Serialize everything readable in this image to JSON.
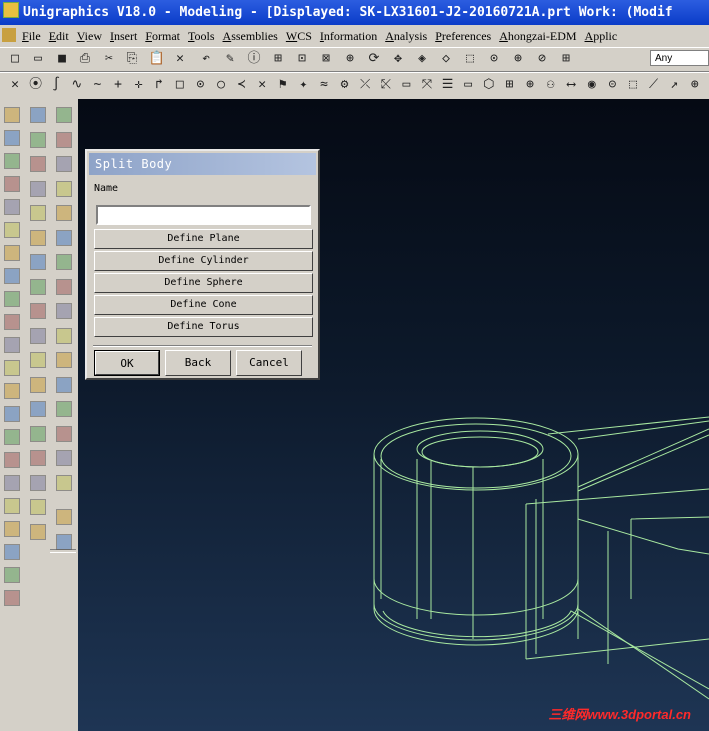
{
  "window": {
    "title": "Unigraphics V18.0 - Modeling - [Displayed: SK-LX31601-J2-20160721A.prt   Work:  (Modif"
  },
  "menu": [
    "File",
    "Edit",
    "View",
    "Insert",
    "Format",
    "Tools",
    "Assemblies",
    "WCS",
    "Information",
    "Analysis",
    "Preferences",
    "Ahongzai-EDM",
    "Applic"
  ],
  "toolbar": {
    "row1_icons": [
      "new-icon",
      "open-icon",
      "save-icon",
      "print-icon",
      "cut-icon",
      "copy-icon",
      "paste-icon",
      "delete-icon",
      "undo-icon",
      "edit-icon",
      "info-icon",
      "tree-icon",
      "measure-icon",
      "fit-icon",
      "zoom-region-icon",
      "zoom-icon",
      "rotate-icon",
      "pan-icon",
      "iso-view-icon",
      "shaded-view-icon",
      "snap-icon",
      "snap-end-icon",
      "snap-mid-icon",
      "layer-icon"
    ],
    "row1_glyphs": [
      "□",
      "▭",
      "■",
      "⎙",
      "✂",
      "⎘",
      "📋",
      "✕",
      "↶",
      "✎",
      "ⓘ",
      "⊞",
      "⊡",
      "⊠",
      "⊕",
      "⟳",
      "✥",
      "◈",
      "◇",
      "⬚",
      "⊙",
      "⊕",
      "⊘",
      "⊞"
    ],
    "filter_value": "Any",
    "row2_glyphs": [
      "✕",
      "⦿",
      "∫",
      "∿",
      "∼",
      "+",
      "✛",
      "↱",
      "□",
      "⊙",
      "○",
      "≺",
      "✕",
      "⚑",
      "✦",
      "≈",
      "⚙",
      "⤫",
      "⤪",
      "▭",
      "⤧",
      "☰",
      "▭",
      "⬡",
      "⊞",
      "⊕",
      "⚇",
      "⟷",
      "◉",
      "⊝",
      "⬚",
      "⟋",
      "↗",
      "⊕"
    ]
  },
  "dialog": {
    "title": "Split Body",
    "name_label": "Name",
    "name_value": "",
    "options": [
      "Define Plane",
      "Define Cylinder",
      "Define Sphere",
      "Define Cone",
      "Define Torus"
    ],
    "ok": "OK",
    "back": "Back",
    "cancel": "Cancel"
  },
  "colors": {
    "wireframe": "#a8e8a0",
    "viewport_top": "#050a14",
    "viewport_bottom": "#1e3554",
    "title_bar": "#0a3cc8"
  },
  "watermark": "三维网www.3dportal.cn"
}
